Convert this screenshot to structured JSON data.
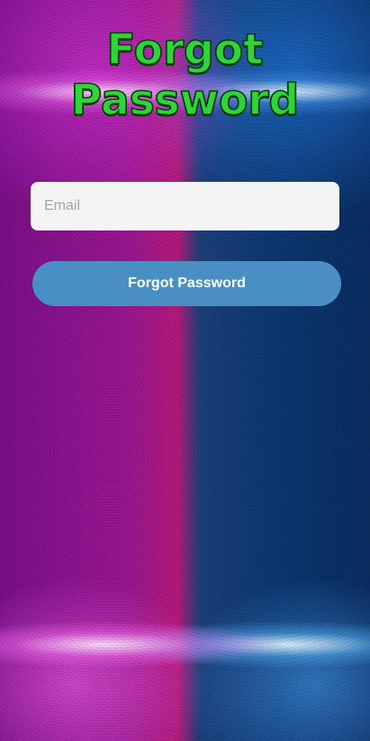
{
  "page": {
    "title_line1": "Forgot",
    "title_line2": "Password"
  },
  "form": {
    "email_placeholder": "Email",
    "email_value": "",
    "submit_label": "Forgot Password"
  },
  "colors": {
    "title": "#2fd33a",
    "button": "#4a8fc3",
    "input_bg": "#f4f4f4"
  }
}
